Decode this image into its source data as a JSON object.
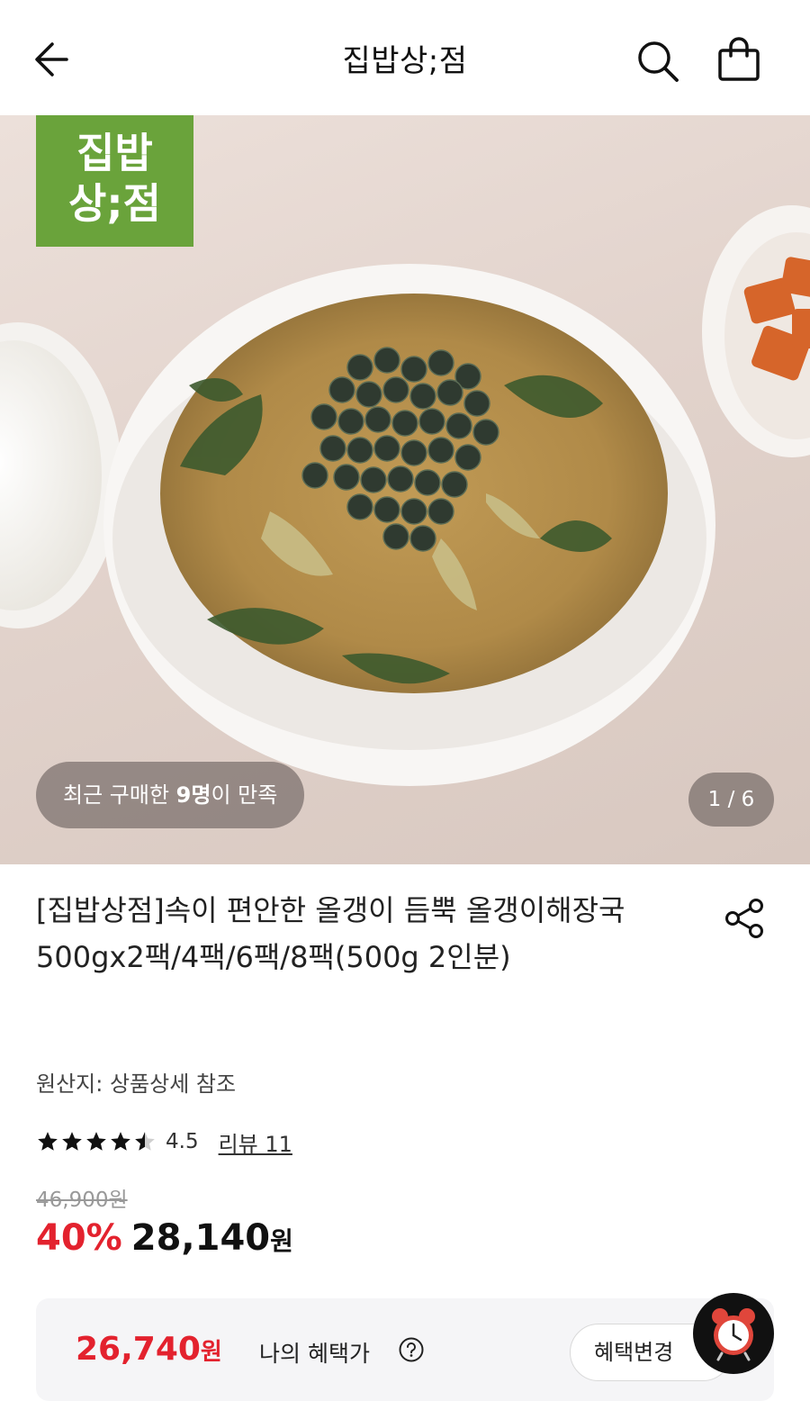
{
  "header": {
    "title": "집밥상;점",
    "back_icon": "arrow-left-icon",
    "search_icon": "search-icon",
    "cart_icon": "shopping-bag-icon"
  },
  "hero": {
    "logo_line1": "집밥",
    "logo_line2": "상;점",
    "logo_color": "#6aa33b",
    "satisfaction_prefix": "최근 구매한 ",
    "satisfaction_count": "9명",
    "satisfaction_suffix": "이 만족",
    "page_indicator": "1 / 6"
  },
  "product": {
    "title": "[집밥상점]속이 편안한 올갱이 듬뿍 올갱이해장국 500gx2팩/4팩/6팩/8팩(500g 2인분)",
    "origin": "원산지: 상품상세 참조",
    "rating": "4.5",
    "rating_value": 4.5,
    "review_link": "리뷰 11",
    "original_price": "46,900원",
    "discount_rate": "40%",
    "sale_price": "28,140",
    "sale_unit": "원",
    "accent_color": "#e3222e",
    "share_icon": "share-icon"
  },
  "benefit": {
    "price": "26,740",
    "unit": "원",
    "label": "나의 혜택가",
    "help_icon": "question-circle-icon",
    "change_button": "혜택변경",
    "fab_icon": "alarm-clock-icon"
  }
}
